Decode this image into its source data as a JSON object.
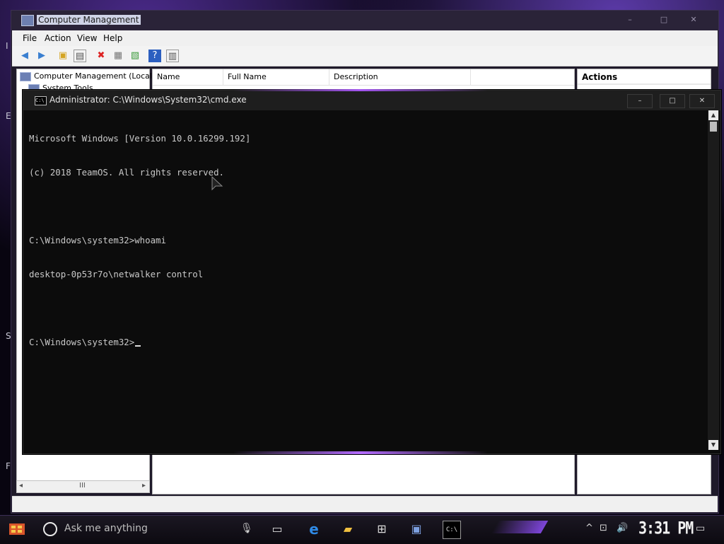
{
  "desktop": {
    "edge_letters": [
      "I",
      "E",
      "S",
      "F"
    ]
  },
  "computer_management": {
    "title": "Computer Management",
    "menu": [
      "File",
      "Action",
      "View",
      "Help"
    ],
    "tree": {
      "root": "Computer Management (Local)",
      "child": "System Tools"
    },
    "columns": [
      "Name",
      "Full Name",
      "Description"
    ],
    "actions_header": "Actions",
    "tree_scroll_mark": "III"
  },
  "cmd": {
    "title": "Administrator: C:\\Windows\\System32\\cmd.exe",
    "lines": [
      "Microsoft Windows [Version 10.0.16299.192]",
      "(c) 2018 TeamOS. All rights reserved.",
      "",
      "C:\\Windows\\system32>whoami",
      "desktop-0p53r7o\\netwalker control",
      "",
      "C:\\Windows\\system32>"
    ],
    "icon_text": "C:\\"
  },
  "taskbar": {
    "search_placeholder": "Ask me anything",
    "clock": "3:31 PM"
  },
  "colors": {
    "accent": "#a457f0",
    "console_bg": "#0c0c0c",
    "console_fg": "#c9c9c9"
  }
}
